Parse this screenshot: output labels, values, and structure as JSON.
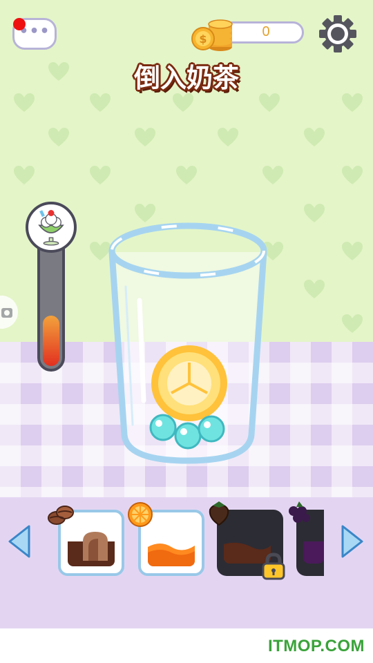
{
  "header": {
    "title": "倒入奶茶",
    "coins": "0"
  },
  "progress": {
    "fill_fraction": 0.4,
    "badge": "parfait-cup-icon"
  },
  "ingredients": [
    {
      "icon": "coffee-beans-icon",
      "color": "#a9715a",
      "locked": false
    },
    {
      "icon": "orange-slice-icon",
      "color": "#ff8a20",
      "locked": false
    },
    {
      "icon": "strawberry-icon",
      "color": "#5a2a1a",
      "locked": true
    },
    {
      "icon": "grape-icon",
      "color": "#5a1a6a",
      "locked": true
    }
  ],
  "watermark": "ITMOP.COM",
  "colors": {
    "wall": "#e4f5c8",
    "floor": "#ddcdee",
    "title_outline": "#7b2a10",
    "cup_outline": "#a6d4f0",
    "boba": "#6fe3e0",
    "lemon": "#ffc23a"
  }
}
